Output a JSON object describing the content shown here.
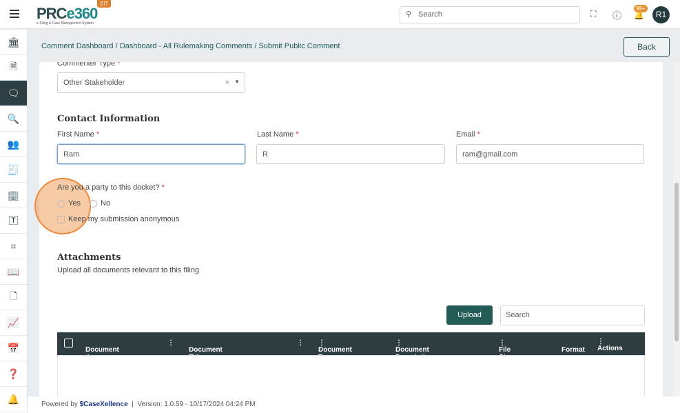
{
  "header": {
    "logo": "PRCe360",
    "logo_sub": "e-Filing & Case Management System",
    "env_badge": "SIT",
    "search_placeholder": "Search",
    "notifications": "99+",
    "avatar": "R1"
  },
  "sidebar": {
    "icons": [
      "bank-icon",
      "document-icon",
      "comment-icon",
      "search-document-icon",
      "users-icon",
      "invoice-icon",
      "building-icon",
      "template-icon",
      "scan-icon",
      "book-icon",
      "file-icon",
      "chart-icon",
      "calendar-icon",
      "help-icon",
      "bell-icon"
    ],
    "active": 2
  },
  "breadcrumb": "Comment Dashboard / Dashboard - All Rulemaking Comments / Submit Public Comment",
  "back_label": "Back",
  "form": {
    "commenter_type_label": "Commenter Type",
    "commenter_type_value": "Other Stakeholder",
    "contact_heading": "Contact Information",
    "first_name_label": "First Name",
    "first_name_value": "Ram",
    "last_name_label": "Last Name",
    "last_name_value": "R",
    "email_label": "Email",
    "email_value": "ram@gmail.com",
    "party_question": "Are you a party to this docket?",
    "yes": "Yes",
    "no": "No",
    "anonymous_label": "Keep my submission anonymous"
  },
  "attachments": {
    "heading": "Attachments",
    "subtitle": "Upload all documents relevant to this filing",
    "upload_label": "Upload",
    "search_placeholder": "Search",
    "columns": [
      "Document #",
      "Document Title",
      "Document Type",
      "Document Description",
      "File Size",
      "Format",
      "Actions"
    ]
  },
  "footer": {
    "powered_by": "Powered by",
    "brand": "CaseXellence",
    "version": "Version: 1.0.59 - 10/17/2024 04:24 PM"
  }
}
